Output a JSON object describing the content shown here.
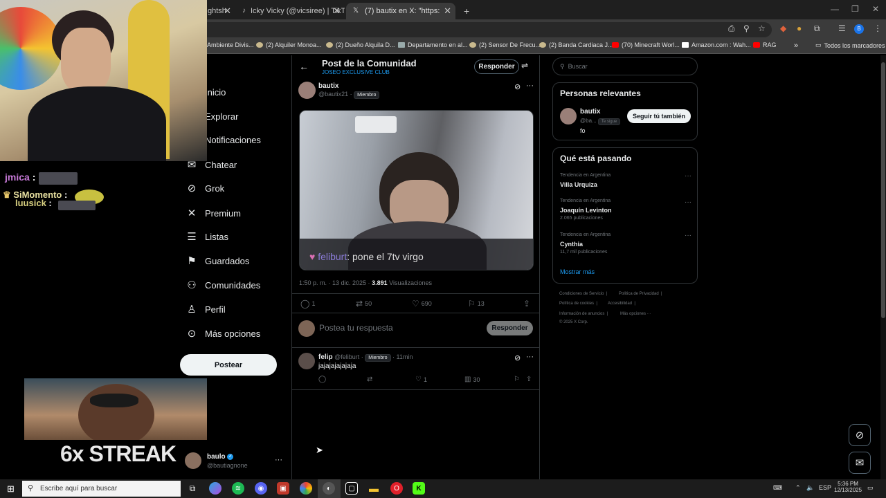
{
  "browser": {
    "tabs": [
      {
        "label": "ghtsh",
        "active": false
      },
      {
        "label": "Icky Vicky (@vicsiree) | TikTok",
        "active": false
      },
      {
        "label": "(7) bautix en X: \"https://t.co/jov",
        "active": true
      }
    ],
    "new_tab": "+",
    "bookmarks": [
      "Ambiente Divis...",
      "(2) Alquiler Monoa...",
      "(2) Dueño Alquila D...",
      "Departamento en al...",
      "(2) Sensor De Frecu...",
      "(2) Banda Cardiaca J...",
      "(70) Minecraft Worl...",
      "Amazon.com : Wah...",
      "RAG"
    ],
    "bookmarks_folder": "Todos los marcadores",
    "profile_initial": "B"
  },
  "nav": {
    "items": [
      "Inicio",
      "Explorar",
      "Notificaciones",
      "Chatear",
      "Grok",
      "Premium",
      "Listas",
      "Guardados",
      "Comunidades",
      "Perfil",
      "Más opciones"
    ],
    "post_button": "Postear",
    "account": {
      "name": "baulo",
      "handle": "@bautiagnone"
    }
  },
  "header": {
    "title": "Post de la Comunidad",
    "community": "JOSEO EXCLUSIVE CLUB",
    "reply_button": "Responder"
  },
  "post": {
    "author": "bautix",
    "handle": "@bautix21",
    "role": "Miembro",
    "media_caption_user": "feliburt",
    "media_caption_text": ": pone el 7tv virgo",
    "timestamp": "1:50 p. m. · 13 dic. 2025 ·",
    "views": "3.891",
    "views_label": "Visualizaciones",
    "replies": "1",
    "reposts": "50",
    "likes": "690",
    "bookmarks": "13"
  },
  "composer": {
    "placeholder": "Postea tu respuesta",
    "button": "Responder"
  },
  "reply": {
    "author": "felip",
    "handle": "@feliburt",
    "role": "Miembro",
    "time": "11min",
    "text": "jajajajajajaja",
    "likes": "1",
    "views": "30"
  },
  "right": {
    "search_placeholder": "Buscar",
    "relevant": {
      "title": "Personas relevantes",
      "name": "bautix",
      "handle": "@ba...",
      "follows_you": "Te sigue",
      "bio": "fo",
      "follow_button": "Seguir tú también"
    },
    "trending": {
      "title": "Qué está pasando",
      "items": [
        {
          "context": "Tendencia en Argentina",
          "name": "Villa Urquiza",
          "count": ""
        },
        {
          "context": "Tendencia en Argentina",
          "name": "Joaquín Levinton",
          "count": "2.065 publicaciones"
        },
        {
          "context": "Tendencia en Argentina",
          "name": "Cynthia",
          "count": "11,7 mil publicaciones"
        }
      ],
      "show_more": "Mostrar más"
    },
    "footer": {
      "terms": "Condiciones de Servicio",
      "privacy": "Política de Privacidad",
      "cookies": "Política de cookies",
      "accessibility": "Accesibilidad",
      "ads": "Información de anuncios",
      "more": "Más opciones ···",
      "copyright": "© 2025 X Corp."
    }
  },
  "stream": {
    "chat": [
      {
        "user": "jmica",
        "sep": ":"
      },
      {
        "user": "SiMomento",
        "sep": ":"
      },
      {
        "user": "luusick",
        "sep": ":"
      }
    ],
    "streak_text": "6x STREAK"
  },
  "taskbar": {
    "search_placeholder": "Escribe aquí para buscar",
    "language": "ESP",
    "time": "5:36 PM",
    "date": "12/13/2025"
  }
}
